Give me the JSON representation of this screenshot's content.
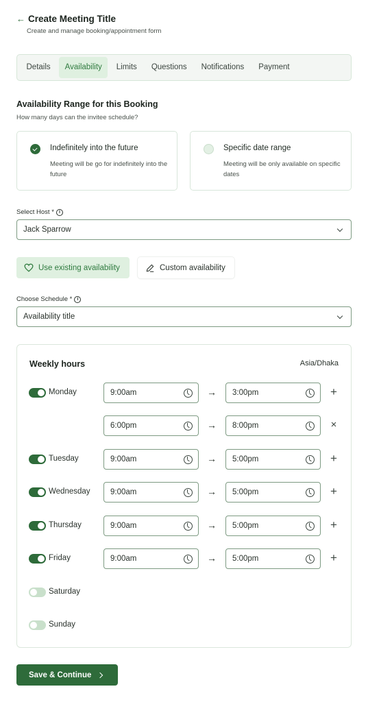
{
  "header": {
    "back_icon": "arrow-left-icon",
    "title": "Create Meeting Title",
    "subtitle": "Create and manage booking/appointment form"
  },
  "tabs": [
    {
      "label": "Details",
      "active": false
    },
    {
      "label": "Availability",
      "active": true
    },
    {
      "label": "Limits",
      "active": false
    },
    {
      "label": "Questions",
      "active": false
    },
    {
      "label": "Notifications",
      "active": false
    },
    {
      "label": "Payment",
      "active": false
    }
  ],
  "availability_range": {
    "title": "Availability Range for this Booking",
    "subtitle": "How many days can the invitee schedule?",
    "options": [
      {
        "label": "Indefinitely into the future",
        "description": "Meeting will be go for indefinitely into the future",
        "selected": true
      },
      {
        "label": "Specific date range",
        "description": "Meeting will be only available on specific dates",
        "selected": false
      }
    ]
  },
  "host": {
    "label": "Select Host *",
    "value": "Jack Sparrow"
  },
  "availability_buttons": {
    "existing": {
      "label": "Use existing availability",
      "icon": "heart-icon",
      "active": true
    },
    "custom": {
      "label": "Custom availability",
      "icon": "pencil-icon",
      "active": false
    }
  },
  "schedule": {
    "label": "Choose Schedule *",
    "value": "Availability title"
  },
  "weekly_hours": {
    "title": "Weekly hours",
    "timezone": "Asia/Dhaka",
    "days": [
      {
        "name": "Monday",
        "enabled": true,
        "slots": [
          {
            "start": "9:00am",
            "end": "3:00pm",
            "action": "add"
          },
          {
            "start": "6:00pm",
            "end": "8:00pm",
            "action": "remove"
          }
        ]
      },
      {
        "name": "Tuesday",
        "enabled": true,
        "slots": [
          {
            "start": "9:00am",
            "end": "5:00pm",
            "action": "add"
          }
        ]
      },
      {
        "name": "Wednesday",
        "enabled": true,
        "slots": [
          {
            "start": "9:00am",
            "end": "5:00pm",
            "action": "add"
          }
        ]
      },
      {
        "name": "Thursday",
        "enabled": true,
        "slots": [
          {
            "start": "9:00am",
            "end": "5:00pm",
            "action": "add"
          }
        ]
      },
      {
        "name": "Friday",
        "enabled": true,
        "slots": [
          {
            "start": "9:00am",
            "end": "5:00pm",
            "action": "add"
          }
        ]
      },
      {
        "name": "Saturday",
        "enabled": false,
        "slots": []
      },
      {
        "name": "Sunday",
        "enabled": false,
        "slots": []
      }
    ],
    "arrow_glyph": "→",
    "add_glyph": "+",
    "remove_glyph": "×"
  },
  "footer": {
    "save_label": "Save & Continue"
  },
  "colors": {
    "primary": "#2e6b3a",
    "active_tab_bg": "#dff0e0",
    "active_tab_text": "#2e7a3e",
    "toggle_off": "#c9e0cb"
  }
}
